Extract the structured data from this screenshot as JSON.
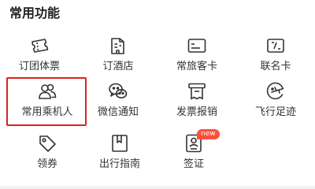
{
  "section": {
    "title": "常用功能"
  },
  "items": [
    {
      "label": "订团体票",
      "icon": "group-ticket-icon"
    },
    {
      "label": "订酒店",
      "icon": "hotel-icon"
    },
    {
      "label": "常旅客卡",
      "icon": "frequent-flyer-card-icon"
    },
    {
      "label": "联名卡",
      "icon": "co-branded-card-icon"
    },
    {
      "label": "常用乘机人",
      "icon": "passengers-icon"
    },
    {
      "label": "微信通知",
      "icon": "wechat-icon"
    },
    {
      "label": "发票报销",
      "icon": "invoice-icon"
    },
    {
      "label": "飞行足迹",
      "icon": "flight-footprint-icon"
    },
    {
      "label": "领券",
      "icon": "coupon-icon"
    },
    {
      "label": "出行指南",
      "icon": "travel-guide-icon"
    },
    {
      "label": "签证",
      "icon": "visa-icon"
    }
  ],
  "badges": {
    "visa": "new"
  },
  "colors": {
    "highlight": "#e02020",
    "badge": "#ff4d3d",
    "text": "#333333",
    "icon_stroke": "#333333"
  }
}
